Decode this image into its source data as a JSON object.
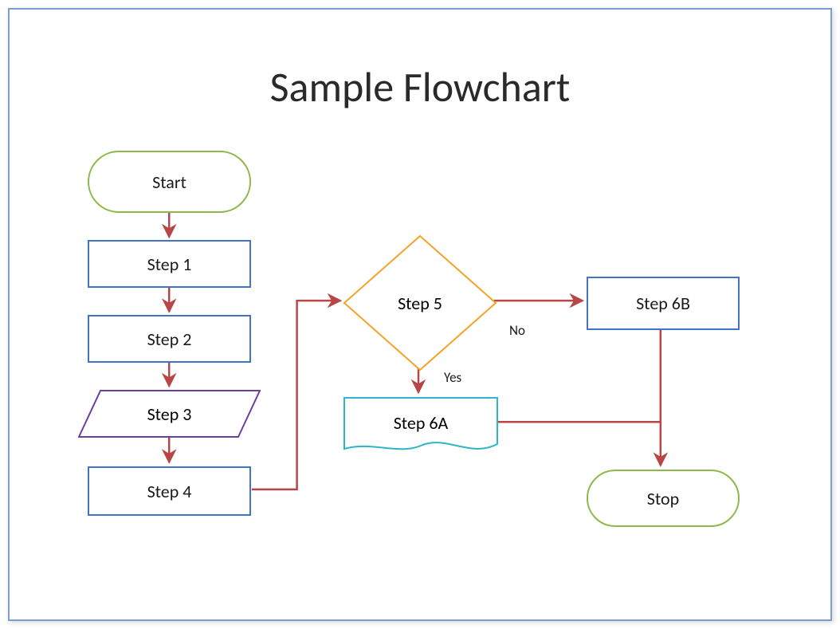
{
  "title": "Sample Flowchart",
  "nodes": {
    "start": {
      "label": "Start"
    },
    "step1": {
      "label": "Step 1"
    },
    "step2": {
      "label": "Step 2"
    },
    "step3": {
      "label": "Step 3"
    },
    "step4": {
      "label": "Step 4"
    },
    "step5": {
      "label": "Step 5"
    },
    "step6a": {
      "label": "Step 6A"
    },
    "step6b": {
      "label": "Step 6B"
    },
    "stop": {
      "label": "Stop"
    }
  },
  "branches": {
    "no": "No",
    "yes": "Yes"
  },
  "colors": {
    "terminator_border": "#8fb84a",
    "process_border": "#4472c4",
    "io_border": "#6b3fa0",
    "decision_border": "#f5a227",
    "document_border": "#2eb5c7",
    "arrow": "#b94646"
  }
}
